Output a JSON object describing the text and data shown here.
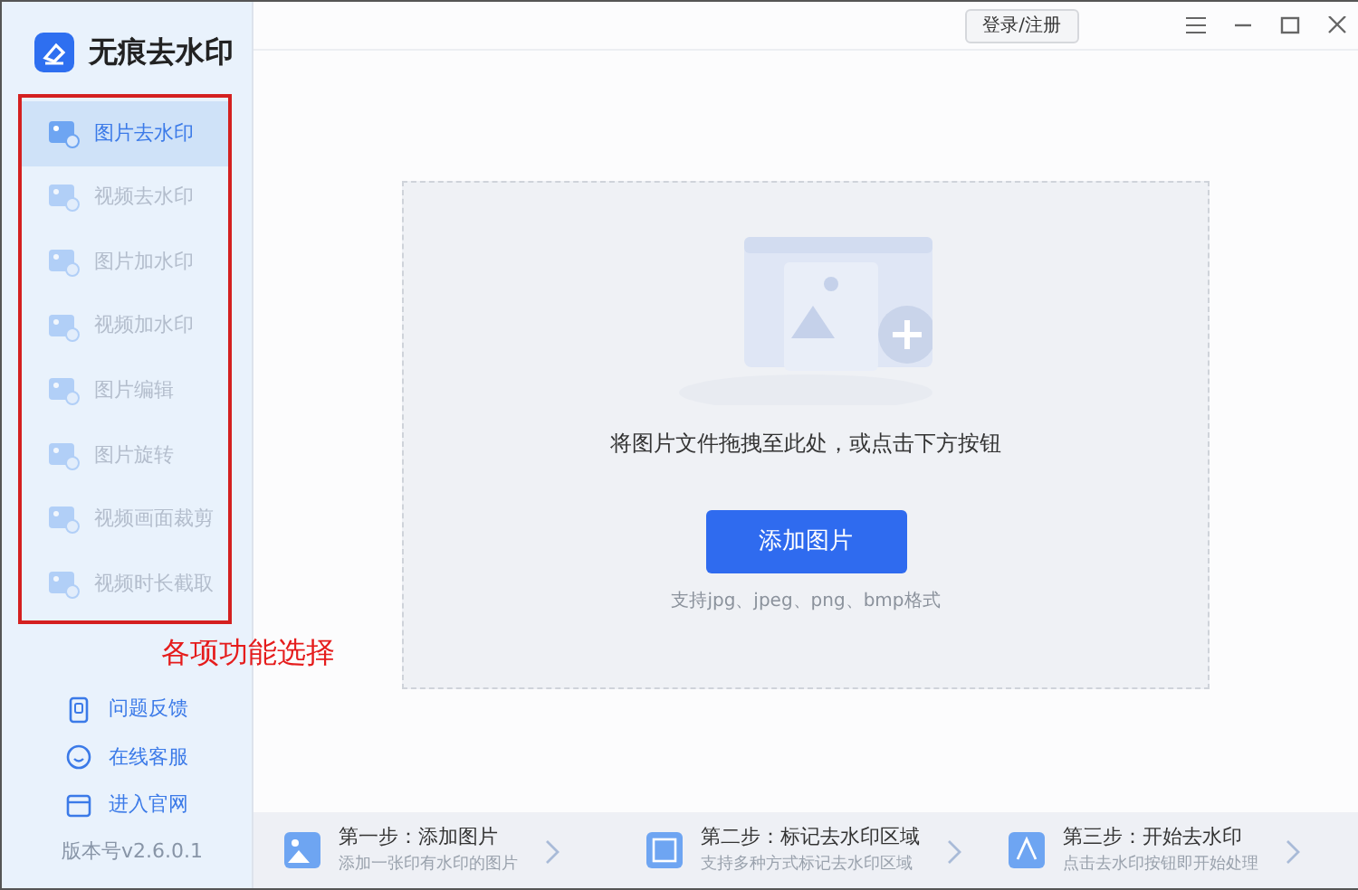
{
  "app": {
    "title": "无痕去水印"
  },
  "titlebar": {
    "login": "登录/注册"
  },
  "sidebar": {
    "items": [
      {
        "label": "图片去水印",
        "selected": true
      },
      {
        "label": "视频去水印",
        "selected": false
      },
      {
        "label": "图片加水印",
        "selected": false
      },
      {
        "label": "视频加水印",
        "selected": false
      },
      {
        "label": "图片编辑",
        "selected": false
      },
      {
        "label": "图片旋转",
        "selected": false
      },
      {
        "label": "视频画面裁剪",
        "selected": false
      },
      {
        "label": "视频时长截取",
        "selected": false
      }
    ],
    "annotation": "各项功能选择",
    "links": [
      {
        "kind": "feedback",
        "label": "问题反馈"
      },
      {
        "kind": "service",
        "label": "在线客服"
      },
      {
        "kind": "website",
        "label": "进入官网"
      }
    ],
    "version": "版本号v2.6.0.1"
  },
  "dropzone": {
    "hint": "将图片文件拖拽至此处，或点击下方按钮",
    "button": "添加图片",
    "formats": "支持jpg、jpeg、png、bmp格式"
  },
  "steps": [
    {
      "title": "第一步：添加图片",
      "desc": "添加一张印有水印的图片"
    },
    {
      "title": "第二步：标记去水印区域",
      "desc": "支持多种方式标记去水印区域"
    },
    {
      "title": "第三步：开始去水印",
      "desc": "点击去水印按钮即开始处理"
    }
  ]
}
